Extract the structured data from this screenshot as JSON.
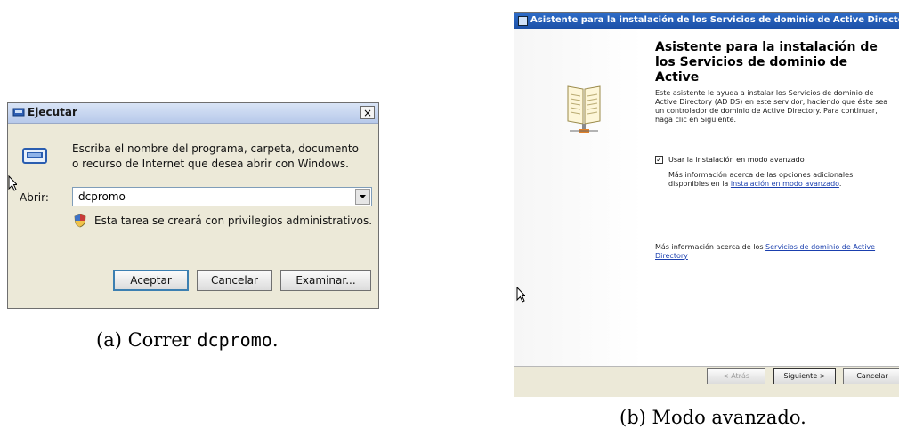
{
  "run_dialog": {
    "title": "Ejecutar",
    "close_glyph": "×",
    "description": "Escriba el nombre del programa, carpeta, documento o recurso de Internet que desea abrir con Windows.",
    "open_label": "Abrir:",
    "command_value": "dcpromo",
    "admin_note": "Esta tarea se creará con privilegios administrativos.",
    "buttons": {
      "ok": "Aceptar",
      "cancel": "Cancelar",
      "browse": "Examinar..."
    }
  },
  "caption_a": {
    "prefix": "(a) Correr ",
    "code": "dcpromo",
    "suffix": "."
  },
  "wizard": {
    "window_title": "Asistente para la instalación de los Servicios de dominio de Active Directory",
    "heading": "Asistente para la instalación de los Servicios de dominio de Active",
    "intro": "Este asistente le ayuda a instalar los Servicios de dominio de Active Directory (AD DS) en este servidor, haciendo que éste sea un controlador de dominio de Active Directory. Para continuar, haga clic en Siguiente.",
    "checkbox_label": "Usar la instalación en modo avanzado",
    "checkbox_checked": true,
    "advanced_text": "Más información acerca de las opciones adicionales disponibles en la ",
    "advanced_link": "instalación en modo avanzado",
    "advanced_suffix": ".",
    "more_text": "Más información acerca de los ",
    "more_link": "Servicios de dominio de Active Directory",
    "buttons": {
      "back": "< Atrás",
      "next": "Siguiente >",
      "cancel": "Cancelar"
    }
  },
  "caption_b": {
    "text": "(b) Modo avanzado."
  },
  "icons": {
    "run": "run-window-icon",
    "shield": "uac-shield-icon",
    "book": "book-icon",
    "cursor": "mouse-cursor-icon"
  },
  "colors": {
    "titlebar_blue": "#1b4fa6",
    "link": "#1a3fae",
    "dialog_bg": "#ece9d8"
  }
}
